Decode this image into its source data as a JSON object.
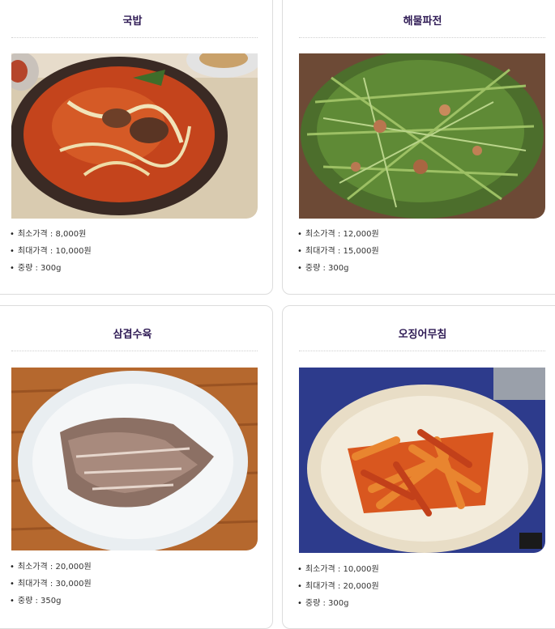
{
  "menu_items": [
    {
      "title": "국밥",
      "specs": [
        {
          "label": "최소가격",
          "value": "8,000원"
        },
        {
          "label": "최대가격",
          "value": "10,000원"
        },
        {
          "label": "중량",
          "value": "300g"
        }
      ]
    },
    {
      "title": "해물파전",
      "specs": [
        {
          "label": "최소가격",
          "value": "12,000원"
        },
        {
          "label": "최대가격",
          "value": "15,000원"
        },
        {
          "label": "중량",
          "value": "300g"
        }
      ]
    },
    {
      "title": "삼겹수육",
      "specs": [
        {
          "label": "최소가격",
          "value": "20,000원"
        },
        {
          "label": "최대가격",
          "value": "30,000원"
        },
        {
          "label": "중량",
          "value": "350g"
        }
      ]
    },
    {
      "title": "오징어무침",
      "specs": [
        {
          "label": "최소가격",
          "value": "10,000원"
        },
        {
          "label": "최대가격",
          "value": "20,000원"
        },
        {
          "label": "중량",
          "value": "300g"
        }
      ]
    }
  ],
  "colors": {
    "title": "#2f1b55",
    "card_border": "#dcdcdc",
    "divider": "#cfcfcf"
  }
}
